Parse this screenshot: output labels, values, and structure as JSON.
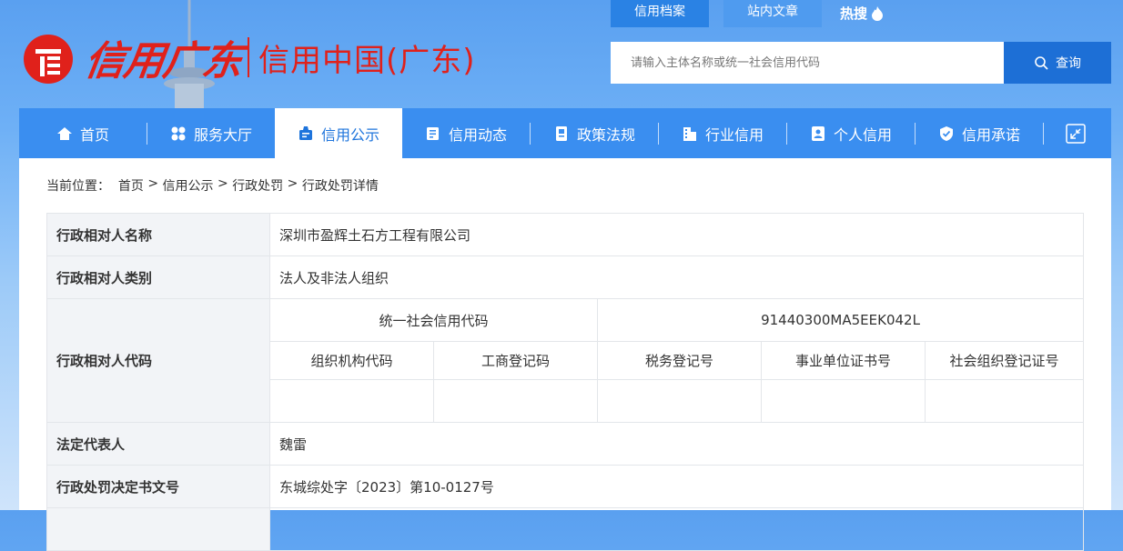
{
  "logo": {
    "script": "信用广东",
    "subtitle": "信用中国(广东)"
  },
  "search": {
    "tabs": [
      "信用档案",
      "站内文章"
    ],
    "hot_label": "热搜",
    "placeholder": "请输入主体名称或统一社会信用代码",
    "button_label": "查询"
  },
  "nav": {
    "items": [
      {
        "label": "首页",
        "icon": "home-icon"
      },
      {
        "label": "服务大厅",
        "icon": "grid-icon"
      },
      {
        "label": "信用公示",
        "icon": "notice-icon"
      },
      {
        "label": "信用动态",
        "icon": "news-icon"
      },
      {
        "label": "政策法规",
        "icon": "document-icon"
      },
      {
        "label": "行业信用",
        "icon": "building-icon"
      },
      {
        "label": "个人信用",
        "icon": "person-card-icon"
      },
      {
        "label": "信用承诺",
        "icon": "shield-icon"
      }
    ],
    "active_index": 2
  },
  "breadcrumb": {
    "prefix": "当前位置：",
    "items": [
      "首页",
      "信用公示",
      "行政处罚",
      "行政处罚详情"
    ],
    "separator": " > "
  },
  "detail": {
    "rows": [
      {
        "label": "行政相对人名称",
        "value": "深圳市盈辉土石方工程有限公司"
      },
      {
        "label": "行政相对人类别",
        "value": "法人及非法人组织"
      },
      {
        "label": "行政相对人代码",
        "uscc_label": "统一社会信用代码",
        "uscc_value": "91440300MA5EEK042L",
        "code_headers": [
          "组织机构代码",
          "工商登记码",
          "税务登记号",
          "事业单位证书号",
          "社会组织登记证号"
        ],
        "code_values": [
          "",
          "",
          "",
          "",
          ""
        ]
      },
      {
        "label": "法定代表人",
        "value": "魏雷"
      },
      {
        "label": "行政处罚决定书文号",
        "value": "东城综处字〔2023〕第10-0127号"
      }
    ]
  },
  "colors": {
    "brand_red": "#e0211b",
    "nav_blue": "#3a8ef0",
    "active_text": "#1e74dc",
    "search_button": "#1d6fd6"
  }
}
